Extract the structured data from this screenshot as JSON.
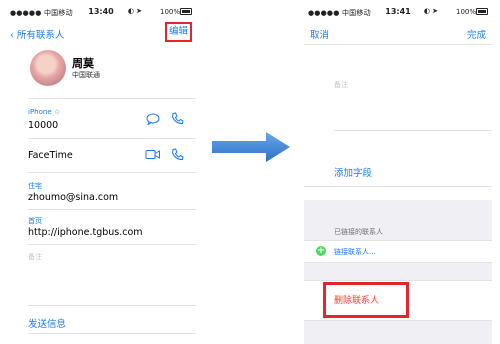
{
  "left_screen": {
    "status": {
      "carrier": "●●●●● 中国移动",
      "time": "13:40",
      "battery": "100%"
    },
    "nav": {
      "back_label": "所有联系人",
      "edit_label": "编辑"
    },
    "contact": {
      "name": "周莫",
      "company": "中国联通"
    },
    "phone": {
      "label": "iPhone ☆",
      "value": "10000"
    },
    "facetime": {
      "label": "FaceTime"
    },
    "home_email": {
      "label": "住宅",
      "value": "zhoumo@sina.com"
    },
    "homepage": {
      "label": "首页",
      "value": "http://iphone.tgbus.com"
    },
    "notes": {
      "hint": "备注"
    },
    "send_message": "发送信息"
  },
  "right_screen": {
    "status": {
      "carrier": "●●●●● 中国移动",
      "time": "13:41",
      "battery": "100%"
    },
    "nav": {
      "cancel_label": "取消",
      "done_label": "完成"
    },
    "notes": {
      "hint": "备注"
    },
    "add_field": "添加字段",
    "linked_title": "已链接的联系人",
    "link_contact": "链接联系人...",
    "delete_contact": "删除联系人"
  },
  "colors": {
    "accent": "#1a7cf5",
    "highlight": "#e3262c",
    "destructive": "#ff3b30",
    "add": "#4cd964"
  }
}
